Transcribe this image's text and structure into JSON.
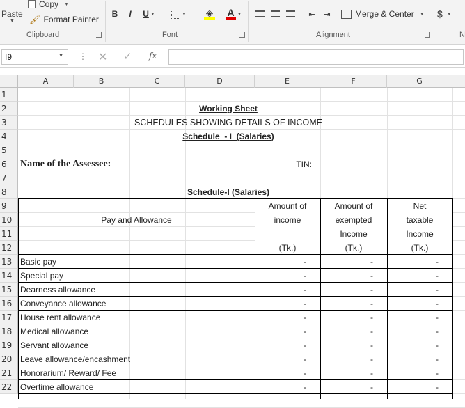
{
  "ribbon": {
    "clipboard": {
      "paste_label": "Paste",
      "copy_label": "Copy",
      "format_painter_label": "Format Painter",
      "group_label": "Clipboard"
    },
    "font": {
      "bold_label": "B",
      "italic_label": "I",
      "underline_label": "U",
      "font_color_glyph": "A",
      "group_label": "Font"
    },
    "alignment": {
      "merge_center_label": "Merge & Center",
      "group_label": "Alignment"
    },
    "number": {
      "currency_label": "$",
      "group_label": "N"
    }
  },
  "formula_bar": {
    "name_box": "I9",
    "fx_label": "fx",
    "content": ""
  },
  "columns": [
    "A",
    "B",
    "C",
    "D",
    "E",
    "F",
    "G"
  ],
  "rows": [
    "1",
    "2",
    "3",
    "4",
    "5",
    "6",
    "7",
    "8",
    "9",
    "10",
    "11",
    "12",
    "13",
    "14",
    "15",
    "16",
    "17",
    "18",
    "19",
    "20",
    "21",
    "22"
  ],
  "sheet": {
    "title": "Working Sheet",
    "subtitle": "SCHEDULES SHOWING DETAILS OF INCOME",
    "schedule_heading": "Schedule  - I  (Salaries)",
    "assessee_label": "Name of the Assessee:",
    "tin_label": "TIN:",
    "table_title": "Schedule-I (Salaries)",
    "header": {
      "pay_allowance": "Pay and Allowance",
      "col_e": [
        "Amount of",
        "income",
        "",
        "(Tk.)"
      ],
      "col_f": [
        "Amount of",
        "exempted",
        "Income",
        "(Tk.)"
      ],
      "col_g": [
        "Net",
        "taxable",
        "Income",
        "(Tk.)"
      ]
    },
    "items": [
      {
        "label": "Basic pay",
        "e": "-",
        "f": "-",
        "g": "-"
      },
      {
        "label": "Special pay",
        "e": "-",
        "f": "-",
        "g": "-"
      },
      {
        "label": "Dearness allowance",
        "e": "-",
        "f": "-",
        "g": "-"
      },
      {
        "label": "Conveyance allowance",
        "e": "-",
        "f": "-",
        "g": "-"
      },
      {
        "label": "House rent allowance",
        "e": "-",
        "f": "-",
        "g": "-"
      },
      {
        "label": "Medical allowance",
        "e": "-",
        "f": "-",
        "g": "-"
      },
      {
        "label": "Servant allowance",
        "e": "-",
        "f": "-",
        "g": "-"
      },
      {
        "label": "Leave allowance/encashment",
        "e": "-",
        "f": "-",
        "g": "-"
      },
      {
        "label": "Honorarium/ Reward/ Fee",
        "e": "-",
        "f": "-",
        "g": "-"
      },
      {
        "label": "Overtime allowance",
        "e": "-",
        "f": "-",
        "g": "-"
      }
    ]
  }
}
